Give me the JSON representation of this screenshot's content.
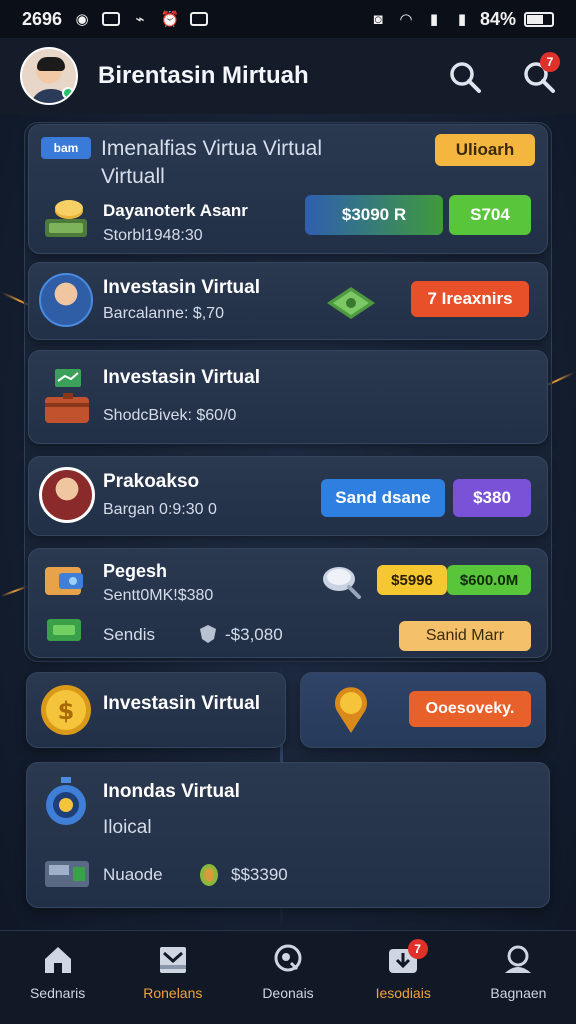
{
  "status_bar": {
    "time": "2696",
    "battery": "84%"
  },
  "header": {
    "title": "Birentasin Mirtuah",
    "notification_count": "7"
  },
  "summary": {
    "tag": "bam",
    "title": "Imenalfias Virtua  Virtual",
    "title2": "Virtuall",
    "button_label": "Ulioarh"
  },
  "rows": [
    {
      "title": "Dayanoterk Asanr",
      "subtitle": "Storbl1948:30",
      "amount": "$3090 R",
      "amount2": "S704"
    },
    {
      "title": "Investasin Virtual",
      "subtitle": "Barcalanne: $,70",
      "button_label": "7 Ireaxnirs"
    },
    {
      "title": "Investasin Virtual",
      "subtitle": "ShodcBivek: $60/0"
    },
    {
      "title": "Prakoakso",
      "subtitle": "Bargan 0:9:30 0",
      "button_label": "Sand dsane",
      "button2_label": "$380"
    },
    {
      "title": "Pegesh",
      "subtitle": "Sentt0MK!$380",
      "tag1": "$5996",
      "tag2": "$600.0M",
      "line2_label": "Sendis",
      "line2_value": "-$3,080",
      "line2_button": "Sanid Marr"
    }
  ],
  "tiles": {
    "left_title": "Investasin Virtual",
    "right_button": "Ooesoveky."
  },
  "bottom_card": {
    "title": "Inondas Virtual",
    "subtitle": "Iloical",
    "line_label": "Nuaode",
    "line_value": "$$3390"
  },
  "nav": {
    "items": [
      {
        "label": "Sednaris"
      },
      {
        "label": "Ronelans"
      },
      {
        "label": "Deonais"
      },
      {
        "label": "Iesodiais"
      },
      {
        "label": "Bagnaen"
      }
    ],
    "badge": "7"
  },
  "colors": {
    "accent_orange": "#f3a23a",
    "button_red": "#e8502a",
    "button_blue": "#2f7fe0",
    "button_purple": "#7a52d8",
    "button_green": "#58c53b",
    "button_yellow": "#f5b640"
  }
}
